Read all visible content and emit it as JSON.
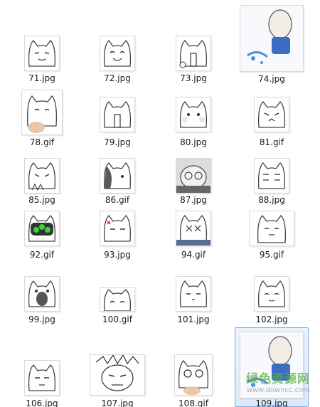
{
  "files": [
    {
      "name": "71.jpg"
    },
    {
      "name": "72.jpg"
    },
    {
      "name": "73.jpg"
    },
    {
      "name": "74.jpg"
    },
    {
      "name": "78.gif"
    },
    {
      "name": "79.jpg"
    },
    {
      "name": "80.jpg"
    },
    {
      "name": "81.gif"
    },
    {
      "name": "85.jpg"
    },
    {
      "name": "86.gif"
    },
    {
      "name": "87.jpg"
    },
    {
      "name": "88.jpg"
    },
    {
      "name": "92.gif"
    },
    {
      "name": "93.jpg"
    },
    {
      "name": "94.gif"
    },
    {
      "name": "95.gif"
    },
    {
      "name": "99.jpg"
    },
    {
      "name": "100.gif"
    },
    {
      "name": "101.jpg"
    },
    {
      "name": "102.jpg"
    },
    {
      "name": "106.jpg"
    },
    {
      "name": "107.jpg"
    },
    {
      "name": "108.gif"
    },
    {
      "name": "109.jpg"
    }
  ],
  "selected_file": "109.jpg",
  "watermark": {
    "text": "绿色资源网",
    "url": "www.downcc.com"
  }
}
